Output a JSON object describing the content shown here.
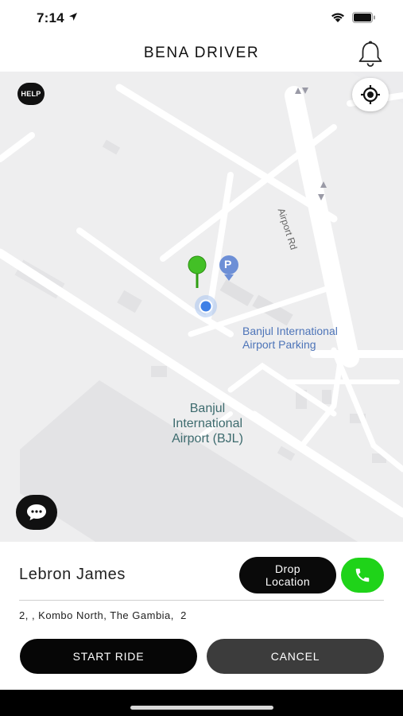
{
  "status": {
    "time": "7:14"
  },
  "header": {
    "title": "BENA DRIVER"
  },
  "map": {
    "help_label": "HELP",
    "airport_label": "Banjul\nInternational\nAirport (BJL)",
    "parking_label": "Banjul International\nAirport Parking",
    "road_label": "Airport Rd",
    "parking_symbol": "P"
  },
  "ride": {
    "rider_name": "Lebron James",
    "drop_label": "Drop\nLocation",
    "address": "2, , Kombo North, The Gambia,  2",
    "start_label": "START RIDE",
    "cancel_label": "CANCEL"
  },
  "colors": {
    "call": "#1fd319",
    "primary": "#060606",
    "secondary": "#3c3c3c"
  }
}
